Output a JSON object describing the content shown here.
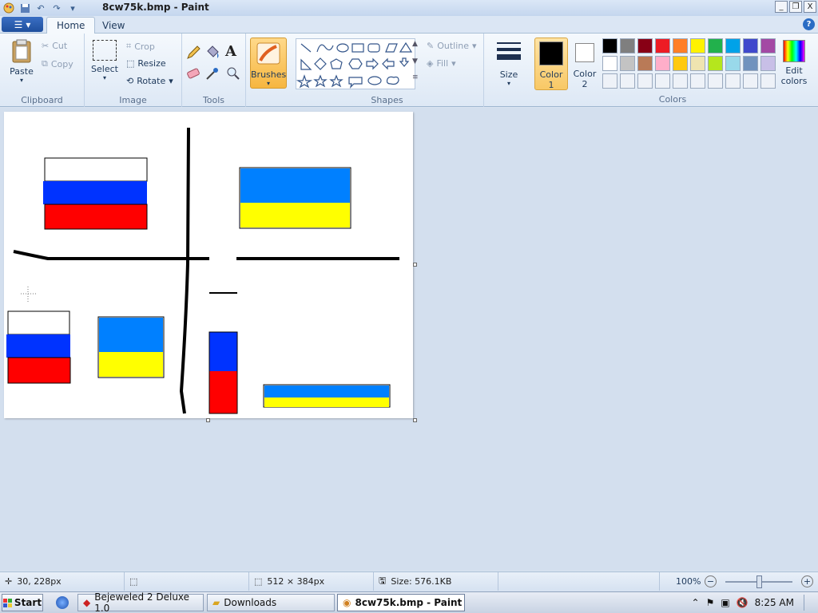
{
  "window": {
    "title": "8cw75k.bmp - Paint",
    "controls": [
      "_",
      "❐",
      "X"
    ]
  },
  "tabs": [
    {
      "label": "Home",
      "active": true
    },
    {
      "label": "View",
      "active": false
    }
  ],
  "ribbon": {
    "clipboard": {
      "paste": "Paste",
      "cut": "Cut",
      "copy": "Copy",
      "label": "Clipboard"
    },
    "image": {
      "select": "Select",
      "crop": "Crop",
      "resize": "Resize",
      "rotate": "Rotate",
      "label": "Image"
    },
    "tools": {
      "label": "Tools"
    },
    "brushes": {
      "label": "Brushes"
    },
    "shapes": {
      "outline": "Outline",
      "fill": "Fill",
      "label": "Shapes"
    },
    "size": {
      "label": "Size"
    },
    "color1": {
      "label": "Color",
      "num": "1"
    },
    "color2": {
      "label": "Color",
      "num": "2"
    },
    "edit_colors": {
      "line1": "Edit",
      "line2": "colors"
    },
    "colors_label": "Colors",
    "palette_row1": [
      "#000000",
      "#7f7f7f",
      "#880015",
      "#ed1c24",
      "#ff7f27",
      "#fff200",
      "#22b14c",
      "#00a2e8",
      "#3f48cc",
      "#a349a4"
    ],
    "palette_row2": [
      "#ffffff",
      "#c3c3c3",
      "#b97a57",
      "#ffaec9",
      "#ffc90e",
      "#efe4b0",
      "#b5e61d",
      "#99d9ea",
      "#7092be",
      "#c8bfe7"
    ]
  },
  "status": {
    "cursor": "30, 228px",
    "selection": "",
    "canvas_size": "512 × 384px",
    "file_size": "Size: 576.1KB",
    "zoom": "100%"
  },
  "taskbar": {
    "start": "Start",
    "items": [
      "Bejeweled 2 Deluxe 1.0",
      "Downloads",
      "8cw75k.bmp - Paint"
    ],
    "clock": "8:25 AM"
  },
  "colors": {
    "flag_blue": "#0033ff",
    "flag_red": "#ff0000",
    "ua_blue": "#0080ff",
    "ua_yellow": "#ffff00"
  }
}
